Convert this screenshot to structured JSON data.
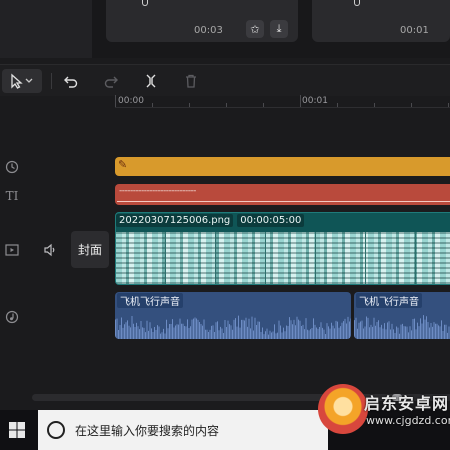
{
  "media": {
    "cards": [
      {
        "duration": "00:03"
      },
      {
        "duration": "00:01"
      }
    ]
  },
  "toolbar": {
    "tools": [
      "select-tool",
      "undo",
      "redo",
      "split",
      "delete"
    ]
  },
  "ruler": {
    "labels": [
      "00:00",
      "00:01"
    ]
  },
  "tracks": {
    "text_placeholder": "----------------------------",
    "video": {
      "filename": "20220307125006.png",
      "duration": "00:00:05:00"
    },
    "audio": [
      {
        "label": "飞机飞行声音"
      },
      {
        "label": "飞机飞行声音"
      }
    ],
    "cover_label": "封面"
  },
  "taskbar": {
    "search_placeholder": "在这里输入你要搜索的内容"
  },
  "watermark": {
    "title": "启东安卓网",
    "url": "www.cjgdzd.com"
  },
  "colors": {
    "sticker_track": "#d89a2c",
    "text_track": "#b94a3c",
    "video_track": "#0f5556",
    "audio_track": "#34507e"
  }
}
